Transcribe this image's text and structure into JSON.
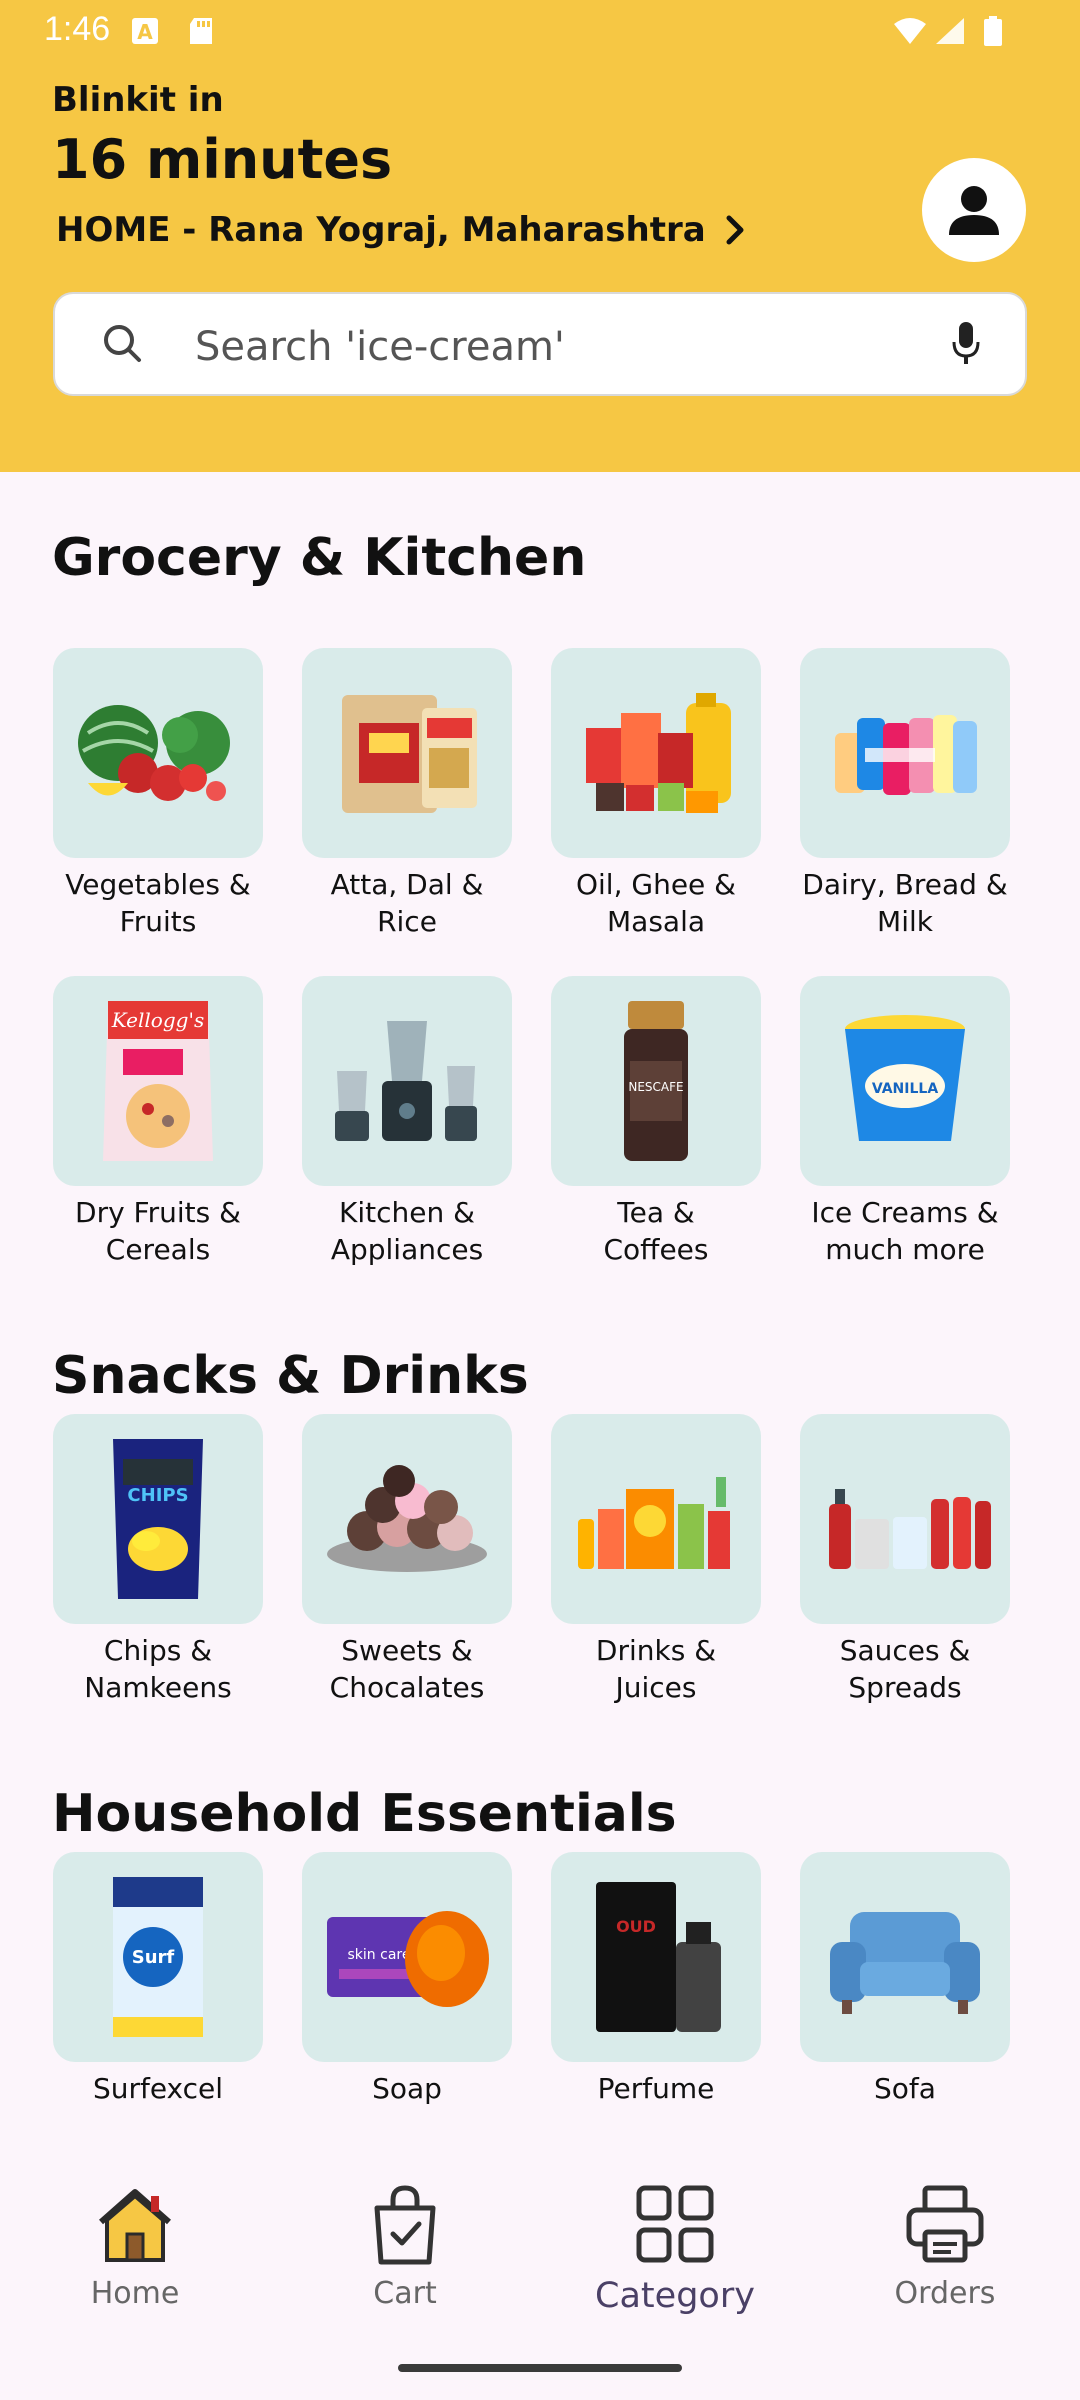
{
  "status": {
    "time": "1:46"
  },
  "header": {
    "brand_sub": "Blinkit in",
    "brand_title": "16 minutes",
    "address": "HOME - Rana Yograj, Maharashtra"
  },
  "search": {
    "placeholder": "Search 'ice-cream'"
  },
  "sections": {
    "grocery": {
      "title": "Grocery & Kitchen",
      "items": [
        {
          "label": "Vegetables &\nFruits",
          "icon": "vegetables-icon"
        },
        {
          "label": "Atta, Dal &\nRice",
          "icon": "atta-icon"
        },
        {
          "label": "Oil, Ghee &\nMasala",
          "icon": "oil-icon"
        },
        {
          "label": "Dairy, Bread &\nMilk",
          "icon": "dairy-icon"
        },
        {
          "label": "Dry Fruits &\nCereals",
          "icon": "cereal-icon"
        },
        {
          "label": "Kitchen &\nAppliances",
          "icon": "mixer-icon"
        },
        {
          "label": "Tea &\nCoffees",
          "icon": "coffee-jar-icon"
        },
        {
          "label": "Ice Creams &\nmuch more",
          "icon": "ice-cream-tub-icon"
        }
      ]
    },
    "snacks": {
      "title": "Snacks & Drinks",
      "items": [
        {
          "label": "Chips &\nNamkeens",
          "icon": "chips-icon"
        },
        {
          "label": "Sweets &\nChocalates",
          "icon": "sweets-icon"
        },
        {
          "label": "Drinks &\nJuices",
          "icon": "drinks-icon"
        },
        {
          "label": "Sauces &\nSpreads",
          "icon": "sauces-icon"
        }
      ]
    },
    "household": {
      "title": "Household Essentials",
      "items": [
        {
          "label": "Surfexcel",
          "icon": "detergent-icon"
        },
        {
          "label": "Soap",
          "icon": "soap-icon"
        },
        {
          "label": "Perfume",
          "icon": "perfume-icon"
        },
        {
          "label": "Sofa",
          "icon": "sofa-icon"
        }
      ]
    }
  },
  "nav": {
    "home": "Home",
    "cart": "Cart",
    "category": "Category",
    "orders": "Orders",
    "active": "Category"
  },
  "colors": {
    "header_bg": "#f6c744",
    "tile_bg": "#d9ebea",
    "page_bg": "#fcf5fb"
  }
}
